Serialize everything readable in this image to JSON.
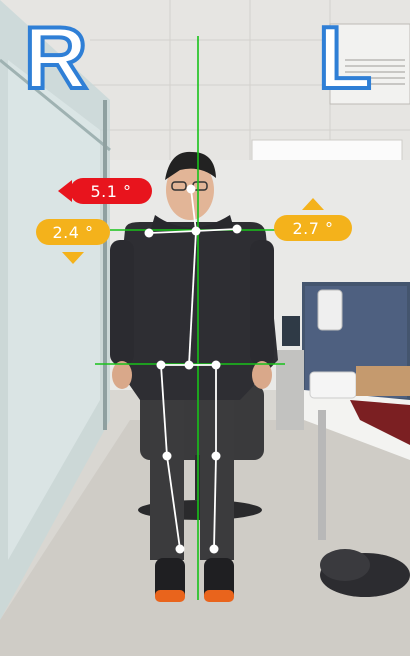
{
  "side_labels": {
    "right": "R",
    "left": "L"
  },
  "measurements": {
    "head_tilt": {
      "value": "5.1 °",
      "direction": "left-arrow",
      "color": "#e8141d"
    },
    "right_shoulder": {
      "value": "2.4 °",
      "direction": "down-arrow",
      "color": "#f4b21b"
    },
    "left_shoulder": {
      "value": "2.7 °",
      "direction": "up-arrow",
      "color": "#f4b21b"
    }
  },
  "colors": {
    "guide_line": "#18c21a",
    "skeleton": "#ffffff",
    "label_outline": "#2f7fd6"
  }
}
